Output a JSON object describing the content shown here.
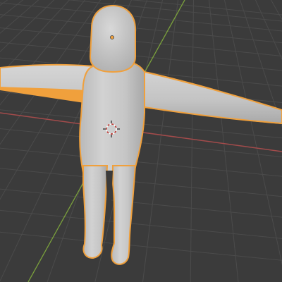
{
  "viewport": {
    "background_color": "#3b3b3b",
    "grid_color": "#4a4a4a",
    "x_axis_color": "#b4504f",
    "y_axis_color": "#7fa33f",
    "selection_outline_color": "#f0a03c",
    "mesh_color": "#c8c8c8"
  },
  "object": {
    "type": "humanoid-mesh",
    "pose": "T-pose",
    "selected": true
  },
  "icons": {
    "origin": "object-origin-icon",
    "cursor": "3d-cursor-icon"
  }
}
